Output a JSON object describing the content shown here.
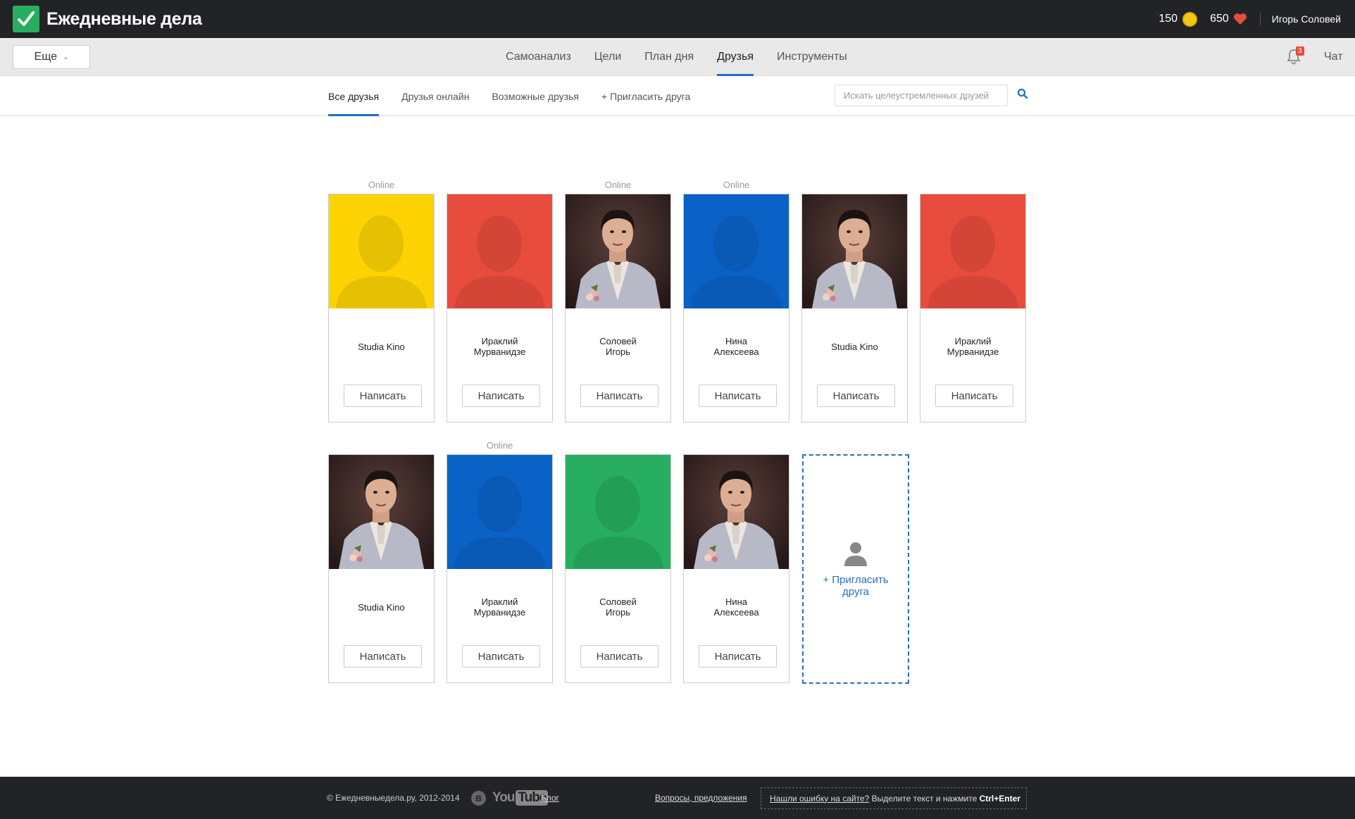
{
  "app": {
    "title": "Ежедневные дела"
  },
  "header": {
    "coins": "150",
    "hearts": "650",
    "user_name": "Игорь Соловей"
  },
  "nav": {
    "more_label": "Еще",
    "items": [
      "Самоанализ",
      "Цели",
      "План дня",
      "Друзья",
      "Инструменты"
    ],
    "active": "Друзья",
    "notifications_count": "3",
    "chat_label": "Чат"
  },
  "subnav": {
    "tabs": [
      "Все друзья",
      "Друзья онлайн",
      "Возможные друзья",
      "+ Пригласить друга"
    ],
    "active": "Все друзья",
    "search_placeholder": "Искать целеустремленных друзей"
  },
  "online_label": "Online",
  "write_label": "Написать",
  "invite_label": "+ Пригласить друга",
  "friends": [
    {
      "name": "Studia Kino",
      "online": true,
      "avatar": "placeholder",
      "color": "#fdd303"
    },
    {
      "name": "Ираклий Мурванидзе",
      "online": false,
      "avatar": "placeholder",
      "color": "#e84c3d"
    },
    {
      "name": "Соловей Игорь",
      "online": true,
      "avatar": "photo",
      "color": "#3a2a28"
    },
    {
      "name": "Нина Алексеева",
      "online": true,
      "avatar": "placeholder",
      "color": "#0a62c7"
    },
    {
      "name": "Studia Kino",
      "online": false,
      "avatar": "photo",
      "color": "#3a2a28"
    },
    {
      "name": "Ираклий Мурванидзе",
      "online": false,
      "avatar": "placeholder",
      "color": "#e84c3d"
    },
    {
      "name": "Studia Kino",
      "online": false,
      "avatar": "photo",
      "color": "#3a2a28"
    },
    {
      "name": "Ираклий Мурванидзе",
      "online": true,
      "avatar": "placeholder",
      "color": "#0a62c7"
    },
    {
      "name": "Соловей Игорь",
      "online": false,
      "avatar": "placeholder",
      "color": "#27ae60"
    },
    {
      "name": "Нина Алексеева",
      "online": false,
      "avatar": "photo",
      "color": "#3a2a28"
    }
  ],
  "footer": {
    "copyright": "© Ежедневныедела.ру, 2012-2014",
    "vk_label": "В",
    "youtube_label": "You",
    "youtube_tube": "Tube",
    "blog": "Блог",
    "feedback": "Вопросы, предложения",
    "bug_link": "Нашли ошибку на сайте?",
    "bug_text": " Выделите текст и нажмите ",
    "bug_keys": "Ctrl+Enter"
  },
  "colors": {
    "accent": "#1e6fc8",
    "topbar": "#222327",
    "logo": "#27ae60"
  }
}
